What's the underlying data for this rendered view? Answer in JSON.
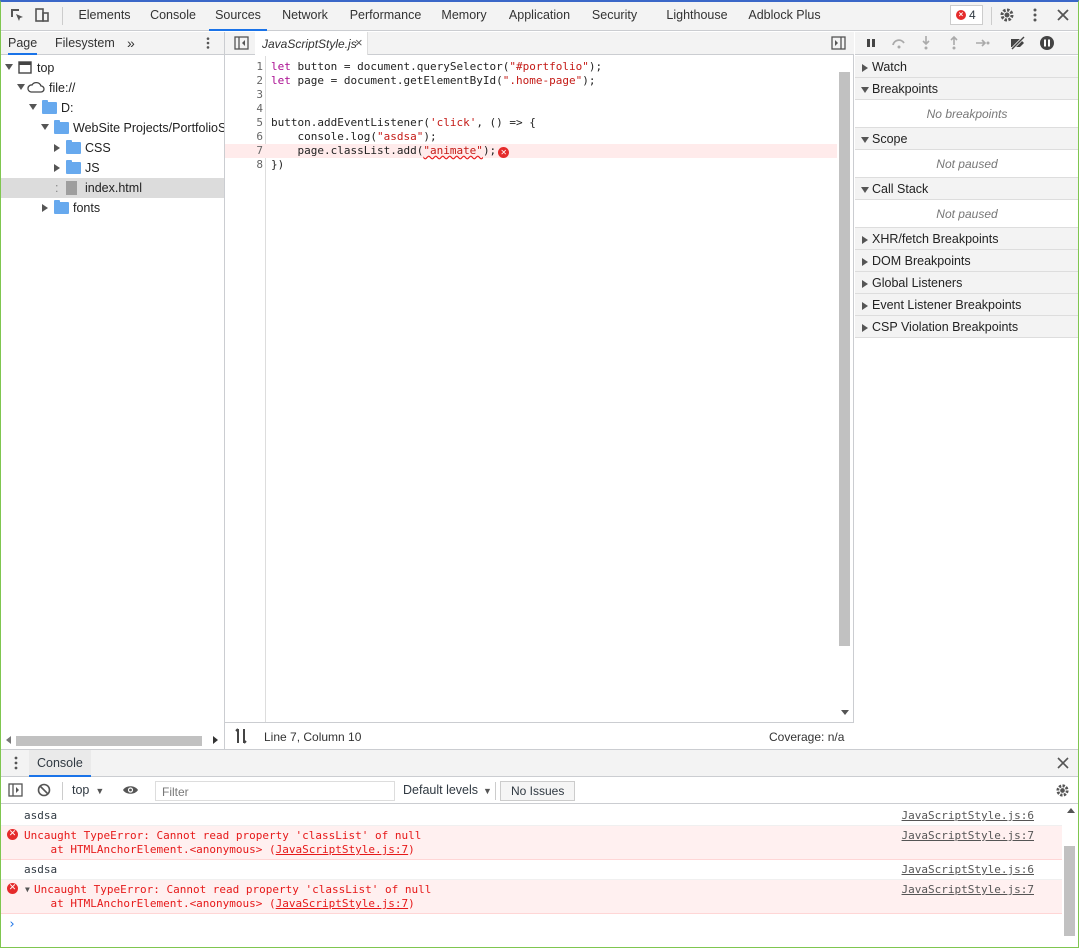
{
  "toolbar": {
    "tabs": [
      "Elements",
      "Console",
      "Sources",
      "Network",
      "Performance",
      "Memory",
      "Application",
      "Security",
      "Lighthouse",
      "Adblock Plus"
    ],
    "active_tab": "Sources",
    "error_count": "4"
  },
  "navigator": {
    "tabs": [
      "Page",
      "Filesystem"
    ],
    "tree": [
      {
        "label": "top"
      },
      {
        "label": "file://"
      },
      {
        "label": "D:"
      },
      {
        "label": "WebSite Projects/PortfolioSit"
      },
      {
        "label": "CSS"
      },
      {
        "label": "JS"
      },
      {
        "label": "index.html"
      },
      {
        "label": "fonts"
      }
    ]
  },
  "editor": {
    "file_tab": "JavaScriptStyle.js",
    "line_numbers": [
      "1",
      "2",
      "3",
      "4",
      "5",
      "6",
      "7",
      "8"
    ],
    "lines": [
      [
        "let",
        " button = document.querySelector(",
        "\"#portfolio\"",
        ");"
      ],
      [
        "let",
        " page = document.getElementById(",
        "\".home-page\"",
        ");"
      ],
      [
        "",
        "",
        "",
        ""
      ],
      [
        "",
        "",
        "",
        ""
      ],
      [
        "",
        "button.addEventListener(",
        "'click'",
        ", () => {"
      ],
      [
        "",
        "    console.log(",
        "\"asdsa\"",
        ");"
      ],
      [
        "",
        "    page.classList.add(",
        "\"animate\"",
        ");"
      ],
      [
        "",
        "})",
        "",
        ""
      ]
    ],
    "status_position": "Line 7, Column 10",
    "coverage": "Coverage: n/a"
  },
  "debugger": {
    "watch": "Watch",
    "breakpoints": "Breakpoints",
    "no_breakpoints": "No breakpoints",
    "scope": "Scope",
    "not_paused_1": "Not paused",
    "call_stack": "Call Stack",
    "not_paused_2": "Not paused",
    "collapsed_sections": [
      "XHR/fetch Breakpoints",
      "DOM Breakpoints",
      "Global Listeners",
      "Event Listener Breakpoints",
      "CSP Violation Breakpoints"
    ]
  },
  "drawer": {
    "tab": "Console",
    "context": "top",
    "filter_placeholder": "Filter",
    "levels": "Default levels",
    "issues": "No Issues",
    "messages": [
      {
        "type": "log",
        "text": "asdsa",
        "source": "JavaScriptStyle.js:6"
      },
      {
        "type": "error",
        "text": "Uncaught TypeError: Cannot read property 'classList' of null",
        "sub": "    at HTMLAnchorElement.<anonymous> (",
        "sublink": "JavaScriptStyle.js:7",
        "subend": ")",
        "source": "JavaScriptStyle.js:7"
      },
      {
        "type": "log",
        "text": "asdsa",
        "source": "JavaScriptStyle.js:6"
      },
      {
        "type": "error",
        "text": "Uncaught TypeError: Cannot read property 'classList' of null",
        "sub": "    at HTMLAnchorElement.<anonymous> (",
        "sublink": "JavaScriptStyle.js:7",
        "subend": ")",
        "source": "JavaScriptStyle.js:7"
      }
    ],
    "prompt": "›"
  }
}
